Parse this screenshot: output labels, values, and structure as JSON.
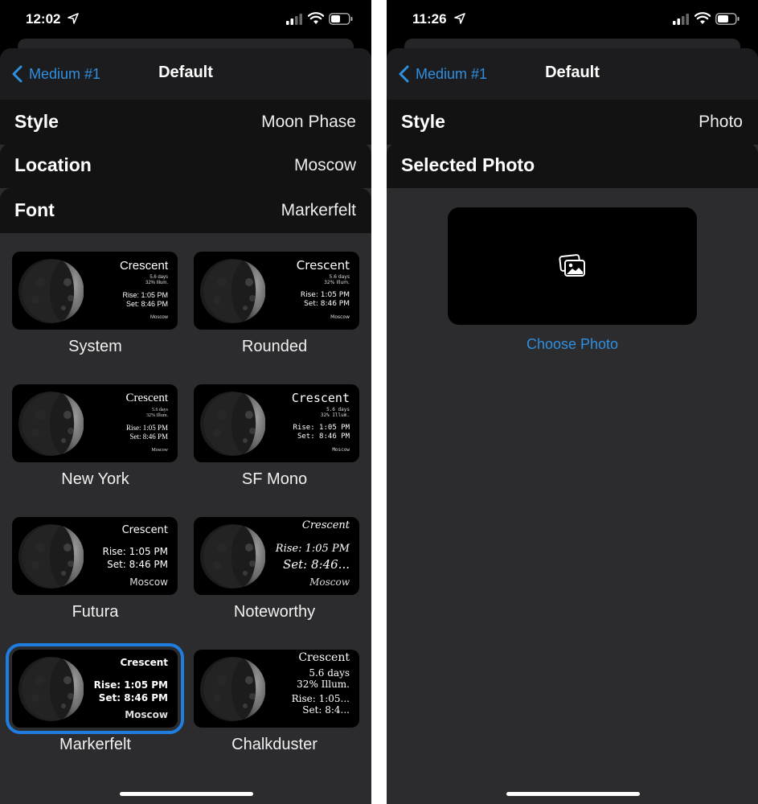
{
  "left_screen": {
    "status": {
      "time": "12:02"
    },
    "nav": {
      "back_label": "Medium #1",
      "title": "Default"
    },
    "rows": [
      {
        "label": "Style",
        "value": "Moon Phase"
      },
      {
        "label": "Location",
        "value": "Moscow"
      },
      {
        "label": "Font",
        "value": "Markerfelt"
      }
    ],
    "widget_text": {
      "phase": "Crescent",
      "age": "5.6 days",
      "illum": "32% Illum.",
      "rise": "Rise:  1:05 PM",
      "set": "Set:  8:46 PM",
      "location": "Moscow",
      "set_truncated": "Set:  8:46...",
      "rise_truncated": "Rise: 1:05...",
      "set_truncated_short": "Set:  8:4..."
    },
    "fonts": [
      {
        "name": "System"
      },
      {
        "name": "Rounded"
      },
      {
        "name": "New York"
      },
      {
        "name": "SF Mono"
      },
      {
        "name": "Futura"
      },
      {
        "name": "Noteworthy"
      },
      {
        "name": "Markerfelt",
        "selected": true
      },
      {
        "name": "Chalkduster"
      }
    ]
  },
  "right_screen": {
    "status": {
      "time": "11:26"
    },
    "nav": {
      "back_label": "Medium #1",
      "title": "Default"
    },
    "rows": [
      {
        "label": "Style",
        "value": "Photo"
      },
      {
        "label": "Selected Photo",
        "value": ""
      }
    ],
    "choose_photo_label": "Choose Photo"
  },
  "colors": {
    "accent": "#2f8fe0",
    "selection": "#1f7de0",
    "background": "#000000",
    "sheet": "#2c2c2e"
  },
  "icons": {
    "back": "chevron-left-icon",
    "location": "location-arrow-icon",
    "signal": "cellular-signal-icon",
    "wifi": "wifi-icon",
    "battery": "battery-icon",
    "photo": "photo-stack-icon",
    "moon": "moon-phase-icon"
  }
}
